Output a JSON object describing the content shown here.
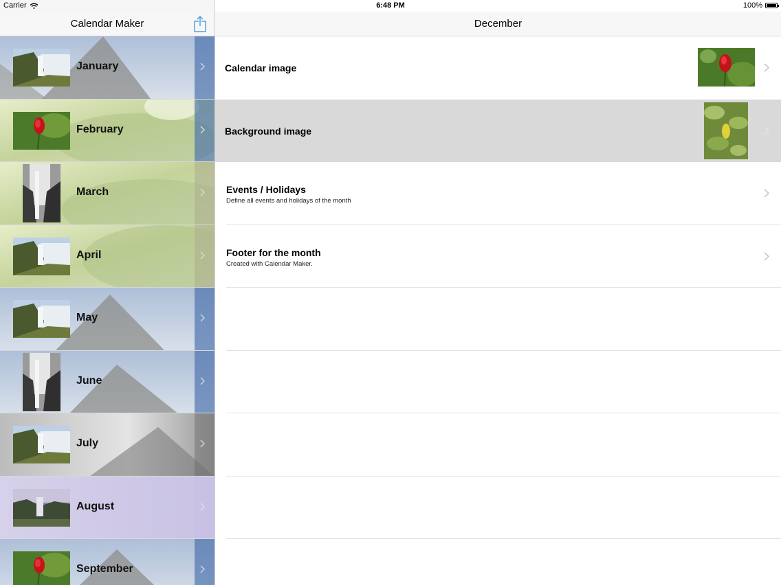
{
  "status_bar": {
    "carrier": "Carrier",
    "time": "6:48 PM",
    "battery": "100%",
    "battery_level": 1.0
  },
  "master": {
    "title": "Calendar Maker",
    "share_icon": "share-icon",
    "months": [
      {
        "label": "January",
        "thumb": "waterfall"
      },
      {
        "label": "February",
        "thumb": "rose"
      },
      {
        "label": "March",
        "thumb": "bw-waterfall"
      },
      {
        "label": "April",
        "thumb": "waterfall"
      },
      {
        "label": "May",
        "thumb": "waterfall"
      },
      {
        "label": "June",
        "thumb": "bw-waterfall"
      },
      {
        "label": "July",
        "thumb": "waterfall"
      },
      {
        "label": "August",
        "thumb": "misty-falls"
      },
      {
        "label": "September",
        "thumb": "rose"
      }
    ]
  },
  "detail": {
    "title": "December",
    "rows": [
      {
        "title": "Calendar image"
      },
      {
        "title": "Background image"
      },
      {
        "title": "Events / Holidays",
        "subtitle": "Define all events and holidays of the month"
      },
      {
        "title": "Footer for the month",
        "subtitle": "Created with Calendar Maker."
      }
    ]
  },
  "colors": {
    "accent": "#4a9bd8",
    "selected_row": "#d9d9d9",
    "chevron": "#c7c7cc"
  }
}
